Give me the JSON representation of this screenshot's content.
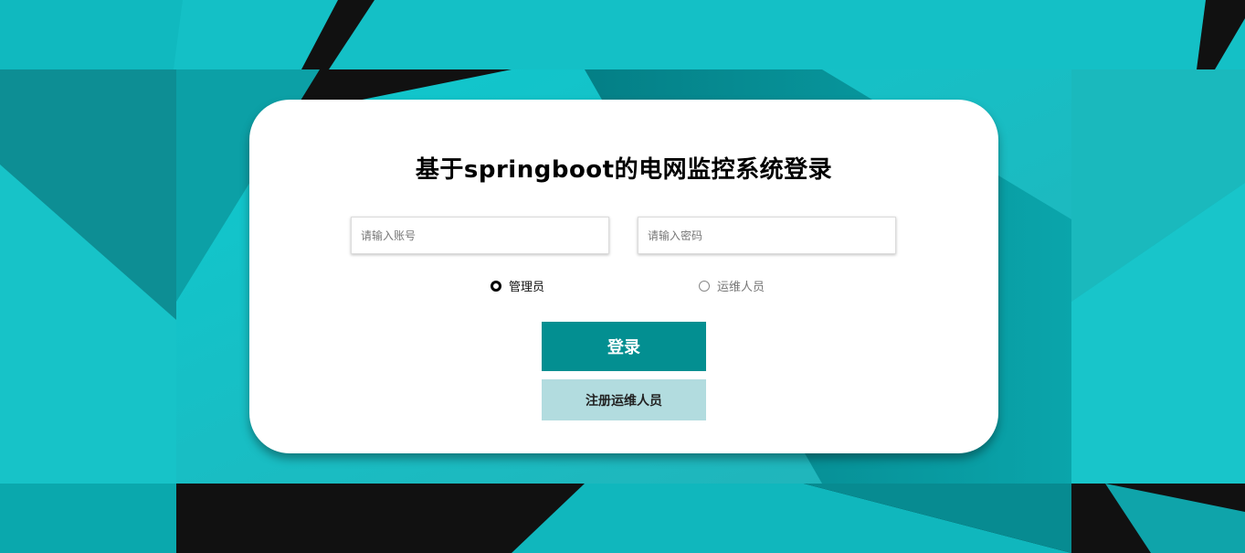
{
  "page": {
    "title": "基于springboot的电网监控系统登录"
  },
  "form": {
    "account_placeholder": "请输入账号",
    "password_placeholder": "请输入密码",
    "roles": [
      {
        "label": "管理员",
        "checked": true
      },
      {
        "label": "运维人员",
        "checked": false
      }
    ],
    "login_label": "登录",
    "register_label": "注册运维人员"
  },
  "colors": {
    "primary": "#038f91",
    "secondary": "#b2dcdf",
    "background_teal": "#0fb8bd",
    "background_dark": "#121212"
  }
}
